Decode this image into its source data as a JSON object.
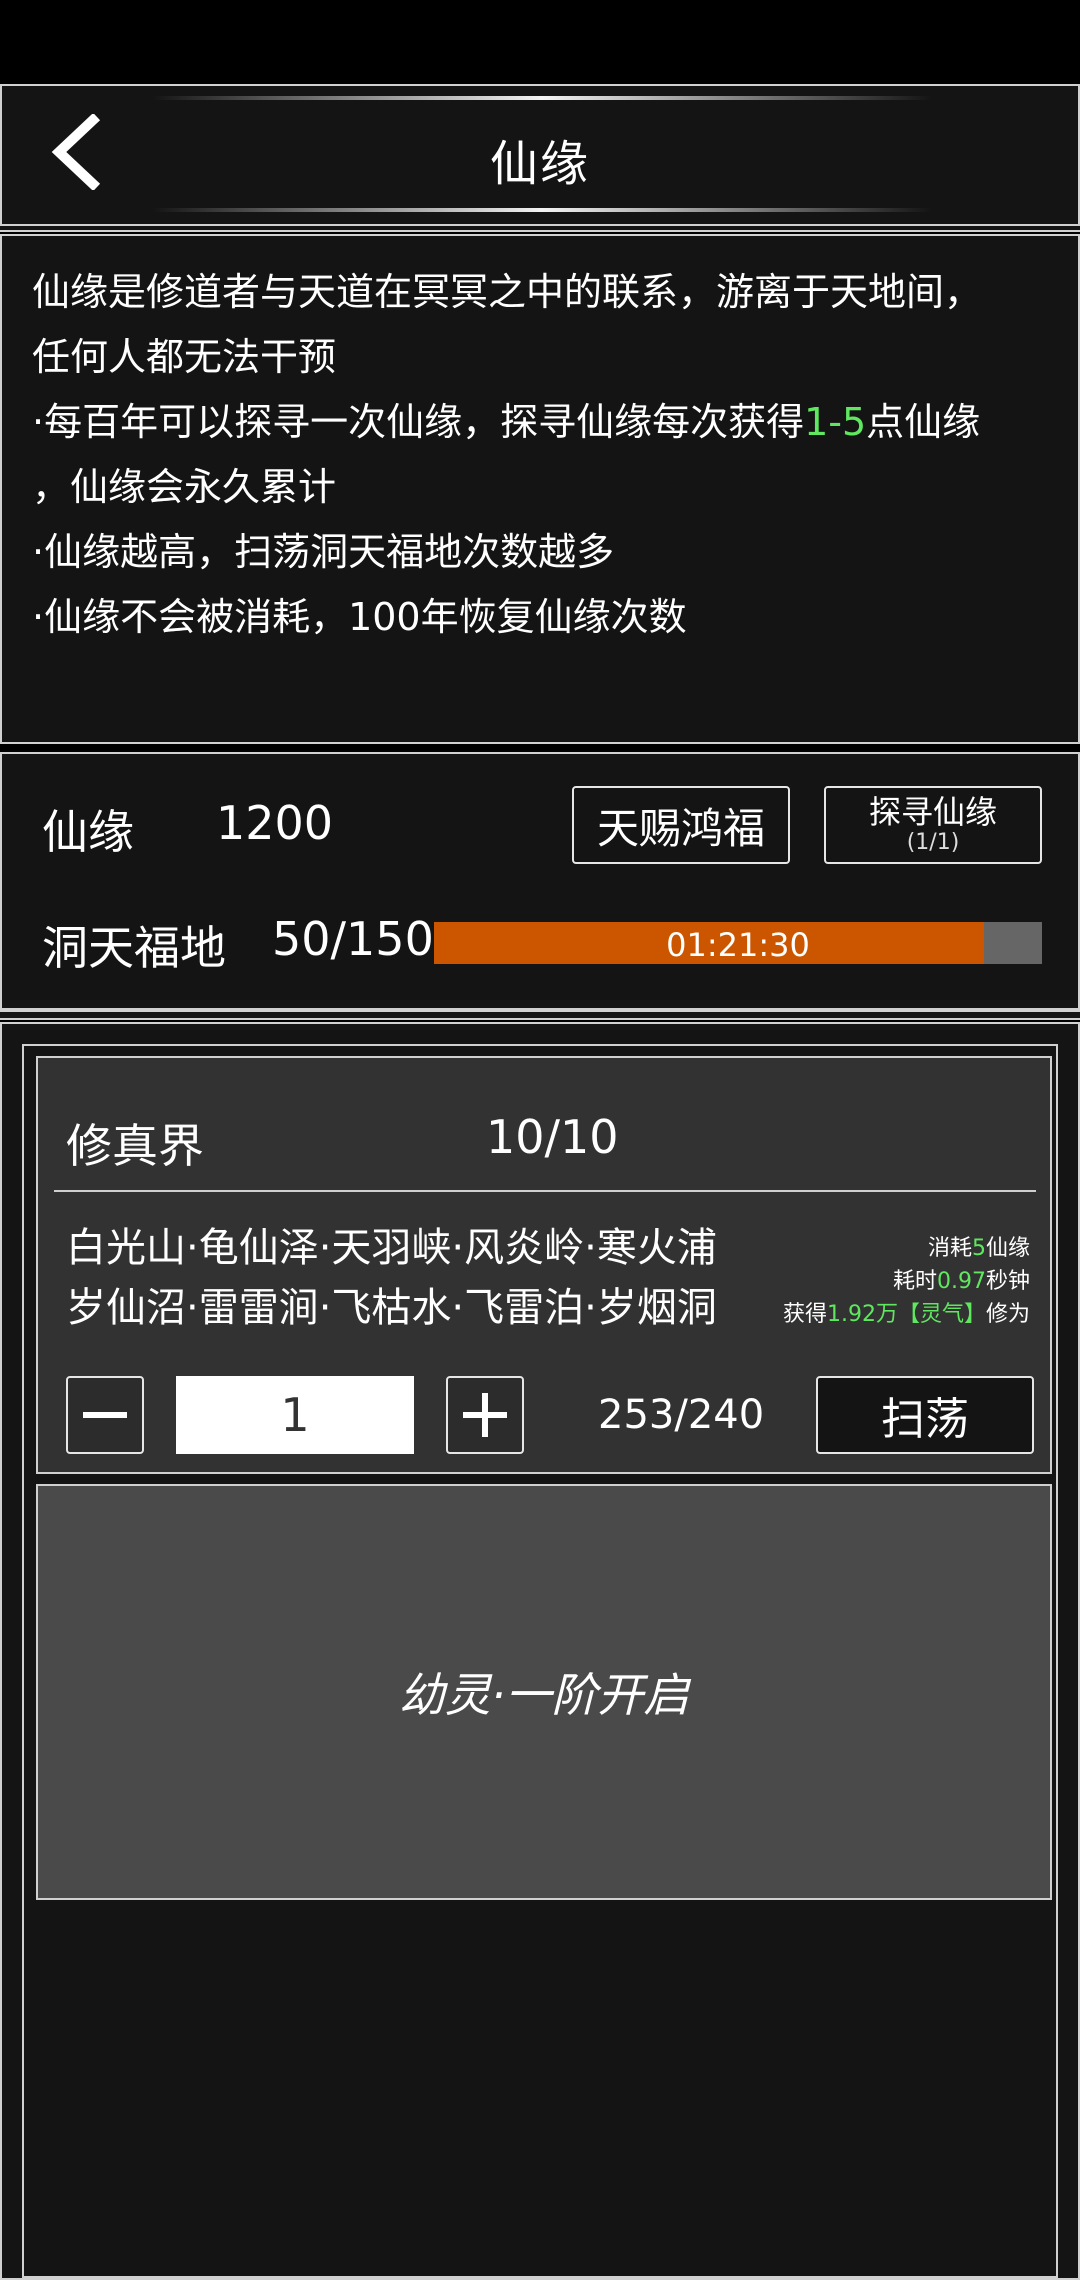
{
  "header": {
    "title": "仙缘",
    "back_icon": "chevron-left-icon"
  },
  "description": {
    "line1": "仙缘是修道者与天道在冥冥之中的联系，游离于天地间，",
    "line2": "任何人都无法干预",
    "line3_prefix": "·每百年可以探寻一次仙缘，探寻仙缘每次获得",
    "line3_highlight": "1-5",
    "line3_suffix": "点仙缘",
    "line4": "，仙缘会永久累计",
    "line5": "·仙缘越高，扫荡洞天福地次数越多",
    "line6": "·仙缘不会被消耗，100年恢复仙缘次数"
  },
  "resources": {
    "xianyuan_label": "仙缘",
    "xianyuan_value": "1200",
    "blessing_button": "天赐鸿福",
    "search_button": "探寻仙缘",
    "search_count": "(1/1)",
    "dongtian_label": "洞天福地",
    "dongtian_value": "50/150",
    "timer": "01:21:30",
    "timer_progress": 0.905
  },
  "realm": {
    "name": "修真界",
    "count": "10/10",
    "locations_line1": "白光山·龟仙泽·天羽峡·风炎岭·寒火浦",
    "locations_line2": "岁仙沼·雷雷涧·飞枯水·飞雷泊·岁烟洞",
    "cost_prefix": "消耗",
    "cost_value": "5",
    "cost_suffix": "仙缘",
    "time_prefix": "耗时",
    "time_value": "0.97",
    "time_suffix": "秒钟",
    "gain_prefix": "获得",
    "gain_value": "1.92万【灵气】",
    "gain_suffix": "修为",
    "quantity": "1",
    "capacity": "253/240",
    "sweep_button": "扫荡"
  },
  "locked": {
    "text": "幼灵·一阶开启"
  },
  "colors": {
    "panel": "#141414",
    "border": "#d0d0d0",
    "highlight_green": "#5fe85f",
    "progress_orange": "#cc5500",
    "progress_track": "#666666"
  }
}
